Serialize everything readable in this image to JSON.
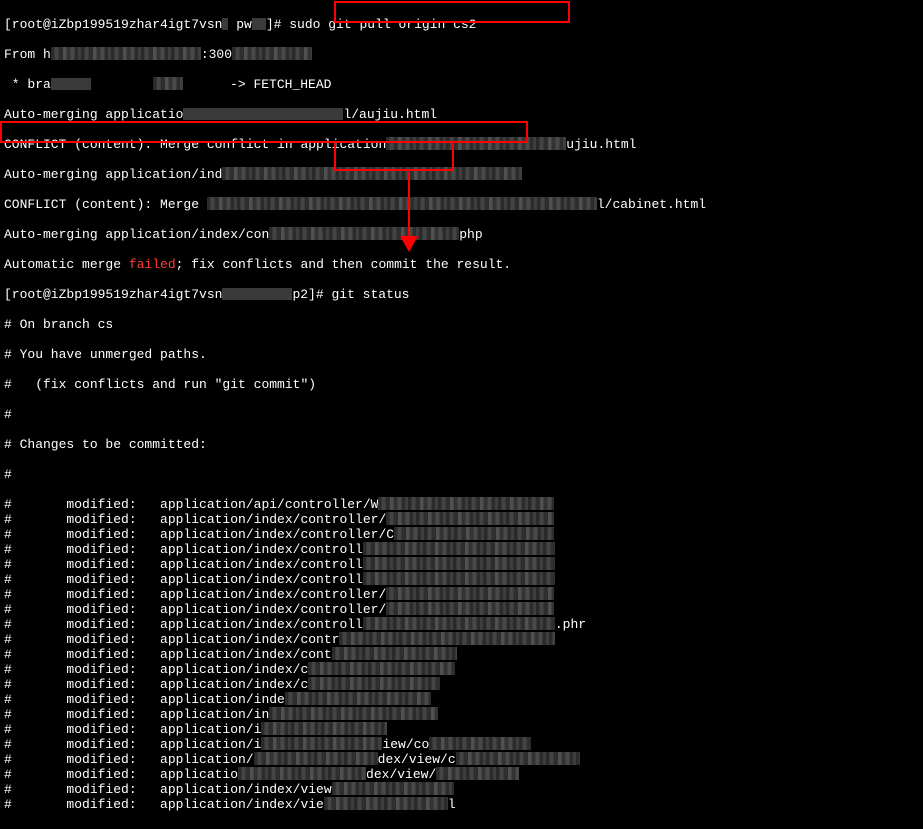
{
  "prompt1_prefix": "[root@iZbp199519zhar4igt7vsn",
  "prompt1_mid": " pw",
  "prompt1_suffix": "]# ",
  "cmd1": "sudo git pull origin cs2",
  "from_prefix": "From h",
  "from_port": ":300",
  "branch_prefix": " * bra",
  "fetch_head_tail": "FETCH_HEAD",
  "automerge1": "Auto-merging applicatio",
  "automerge1_tail": "l/aujiu.html",
  "conflict1": "CONFLICT (content): Merge conflict in application",
  "conflict1_tail": "ujiu.html",
  "automerge2": "Auto-merging application/ind",
  "conflict2": "CONFLICT (content): Merge ",
  "conflict2_tail": "l/cabinet.html",
  "automerge3_a": "Auto-merging application/index/con",
  "automerge3_b": "php",
  "fail_a": "Automatic merge ",
  "fail_b": "failed",
  "fail_c": "; fix conflicts and then commit the result.",
  "prompt2_prefix": "[root@iZbp199519zhar4igt7vsn",
  "prompt2_suffix": "p2]#",
  "cmd2": "git status",
  "status_branch": "# On branch cs",
  "status_unmerged": "# You have unmerged paths.",
  "status_fix": "#   (fix conflicts and run \"git commit\")",
  "status_hash": "#",
  "status_changes": "# Changes to be committed:",
  "files": [
    {
      "left": "#       modified:   application/api/controller/W"
    },
    {
      "left": "#       modified:   application/index/controller/"
    },
    {
      "left": "#       modified:   application/index/controller/C"
    },
    {
      "left": "#       modified:   application/index/controll"
    },
    {
      "left": "#       modified:   application/index/controll"
    },
    {
      "left": "#       modified:   application/index/controll"
    },
    {
      "left": "#       modified:   application/index/controller/"
    },
    {
      "left": "#       modified:   application/index/controller/"
    },
    {
      "left": "#       modified:   application/index/controll",
      "tail": ".phr"
    },
    {
      "left": "#       modified:   application/index/contr"
    },
    {
      "left": "#       modified:   application/index/cont"
    },
    {
      "left": "#       modified:   application/index/c"
    },
    {
      "left": "#       modified:   application/index/c"
    },
    {
      "left": "#       modified:   application/inde"
    },
    {
      "left": "#       modified:   application/in"
    },
    {
      "left": "#       modified:   application/i"
    },
    {
      "left": "#       modified:   application/i",
      "mid": "iew/co"
    },
    {
      "left": "#       modified:   application/",
      "mid": "dex/view/c"
    },
    {
      "left": "#       modified:   applicatio",
      "mid": "dex/view/"
    },
    {
      "left": "#       modified:   application/index/view"
    },
    {
      "left": "#       modified:   application/index/vie",
      "tail": "l"
    }
  ]
}
